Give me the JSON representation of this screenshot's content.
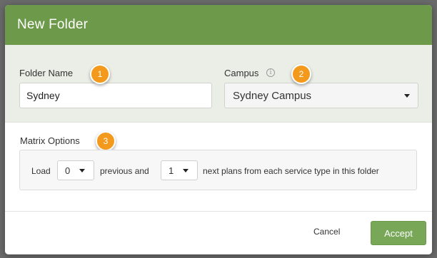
{
  "dialog": {
    "title": "New Folder"
  },
  "folder_name": {
    "label": "Folder Name",
    "value": "Sydney"
  },
  "campus": {
    "label": "Campus",
    "info_icon": "info-circle-icon",
    "selected": "Sydney Campus"
  },
  "matrix": {
    "label": "Matrix Options",
    "load_text": "Load",
    "previous_value": "0",
    "previous_text": "previous and",
    "next_value": "1",
    "next_text": "next plans from each service type in this folder"
  },
  "badges": {
    "one": "1",
    "two": "2",
    "three": "3"
  },
  "footer": {
    "cancel_label": "Cancel",
    "accept_label": "Accept"
  },
  "colors": {
    "header": "#6d9a4a",
    "accept": "#78a857",
    "badge": "#f39a1c"
  }
}
